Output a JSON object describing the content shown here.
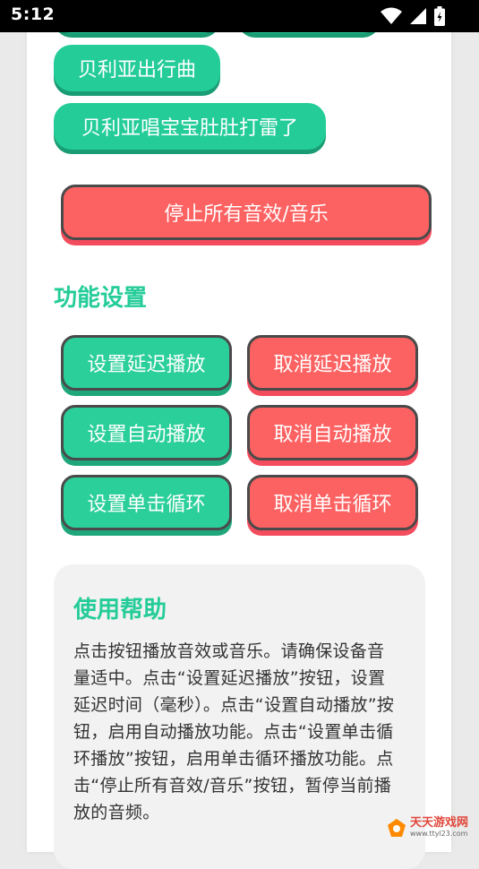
{
  "status_bar": {
    "time": "5:12",
    "icons": [
      "wifi-icon",
      "signal-icon",
      "battery-icon"
    ]
  },
  "playlist": {
    "items": [
      "贝利亚出行曲",
      "贝利亚唱宝宝肚肚打雷了"
    ]
  },
  "stop_button": {
    "label": "停止所有音效/音乐"
  },
  "settings": {
    "title": "功能设置",
    "buttons": [
      {
        "label": "设置延迟播放",
        "color": "#2bcf99"
      },
      {
        "label": "取消延迟播放",
        "color": "#fd6262"
      },
      {
        "label": "设置自动播放",
        "color": "#2bcf99"
      },
      {
        "label": "取消自动播放",
        "color": "#fd6262"
      },
      {
        "label": "设置单击循环",
        "color": "#2bcf99"
      },
      {
        "label": "取消单击循环",
        "color": "#fd6262"
      }
    ]
  },
  "help": {
    "title": "使用帮助",
    "text": "点击按钮播放音效或音乐。请确保设备音量适中。点击“设置延迟播放”按钮，设置延迟时间（毫秒）。点击“设置自动播放”按钮，启用自动播放功能。点击“设置单击循环播放”按钮，启用单击循环播放功能。点击“停止所有音效/音乐”按钮，暂停当前播放的音频。"
  },
  "watermark": {
    "name": "天天游戏网",
    "url": "www.ttyl23.com"
  },
  "colors": {
    "accent": "#24cc98",
    "danger": "#fd6262",
    "background": "#e9eae9"
  }
}
